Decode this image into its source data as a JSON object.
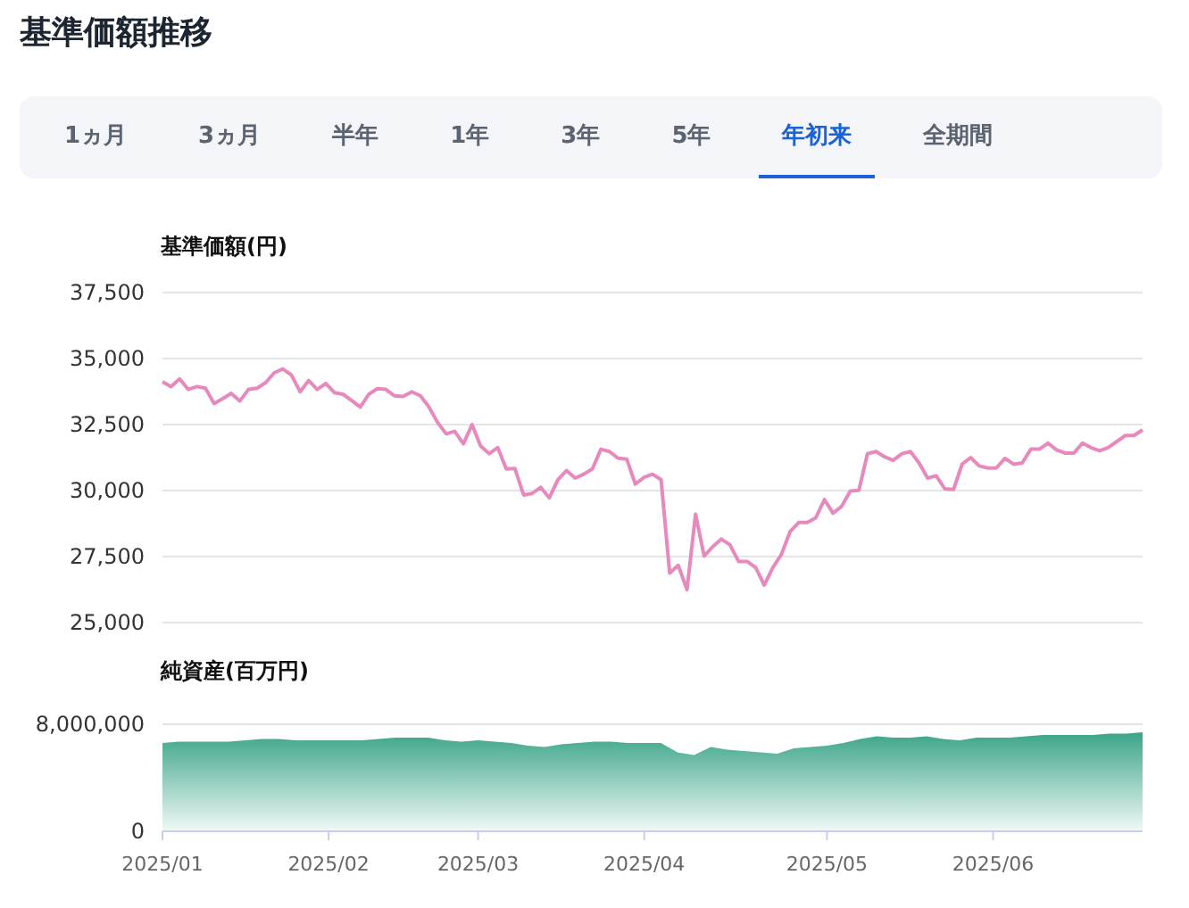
{
  "title": "基準価額推移",
  "tabs": [
    {
      "label": "1ヵ月",
      "selected": false
    },
    {
      "label": "3ヵ月",
      "selected": false
    },
    {
      "label": "半年",
      "selected": false
    },
    {
      "label": "1年",
      "selected": false
    },
    {
      "label": "3年",
      "selected": false
    },
    {
      "label": "5年",
      "selected": false
    },
    {
      "label": "年初来",
      "selected": true
    },
    {
      "label": "全期間",
      "selected": false
    }
  ],
  "price_chart": {
    "chart_data": {
      "type": "line",
      "grid": true,
      "ylabel": "基準価額(円)",
      "ylim": [
        25000,
        37500
      ],
      "yticks": [
        {
          "value": 25000,
          "label": "25,000"
        },
        {
          "value": 27500,
          "label": "27,500"
        },
        {
          "value": 30000,
          "label": "30,000"
        },
        {
          "value": 32500,
          "label": "32,500"
        },
        {
          "value": 35000,
          "label": "35,000"
        },
        {
          "value": 37500,
          "label": "37,500"
        }
      ],
      "categories": [
        null,
        null,
        null,
        null,
        null,
        null,
        null,
        null,
        null,
        null,
        null,
        null,
        null,
        null,
        null,
        null,
        null,
        null,
        null,
        null,
        null,
        null,
        null,
        null,
        null,
        null,
        null,
        null,
        null,
        null,
        null,
        null,
        null,
        null,
        null,
        null,
        null,
        null,
        null,
        null,
        null,
        null,
        null,
        null,
        null,
        null,
        null,
        null,
        null,
        null,
        null,
        null,
        null,
        null,
        null,
        null,
        null,
        null,
        null,
        null,
        null,
        null,
        null,
        null,
        null,
        null,
        null,
        null,
        null,
        null,
        null,
        null,
        null,
        null,
        null,
        null,
        null,
        null,
        null,
        null,
        null,
        null,
        null,
        null,
        null,
        null,
        null,
        null,
        null,
        null,
        null,
        null,
        null,
        null,
        null,
        null,
        null,
        null,
        null,
        null,
        null,
        null,
        null,
        null,
        null,
        null,
        null,
        null,
        null,
        null,
        null,
        null,
        null,
        null,
        null
      ],
      "series": [
        {
          "color": "#e889bd",
          "values": [
            34120,
            33940,
            34230,
            33830,
            33940,
            33880,
            33300,
            33480,
            33680,
            33390,
            33830,
            33880,
            34090,
            34460,
            34610,
            34380,
            33740,
            34170,
            33830,
            34060,
            33710,
            33650,
            33420,
            33160,
            33650,
            33860,
            33830,
            33590,
            33570,
            33740,
            33590,
            33160,
            32580,
            32150,
            32240,
            31770,
            32500,
            31690,
            31400,
            31630,
            30820,
            30840,
            29830,
            29890,
            30120,
            29720,
            30410,
            30760,
            30470,
            30620,
            30820,
            31570,
            31480,
            31220,
            31190,
            30240,
            30500,
            30620,
            30410,
            26880,
            27170,
            26250,
            29110,
            27520,
            27870,
            28160,
            27950,
            27320,
            27320,
            27080,
            26420,
            27080,
            27580,
            28450,
            28790,
            28790,
            28970,
            29660,
            29140,
            29400,
            29980,
            30010,
            31400,
            31480,
            31280,
            31140,
            31400,
            31480,
            31050,
            30470,
            30560,
            30070,
            30040,
            31000,
            31250,
            30930,
            30850,
            30850,
            31220,
            31000,
            31050,
            31570,
            31570,
            31800,
            31540,
            31420,
            31420,
            31800,
            31630,
            31510,
            31630,
            31860,
            32090,
            32090,
            32300
          ]
        }
      ]
    }
  },
  "assets_chart": {
    "chart_data": {
      "type": "area",
      "ylabel": "純資産(百万円)",
      "ylim": [
        0,
        8000000
      ],
      "yticks": [
        {
          "value": 0,
          "label": "0"
        },
        {
          "value": 8000000,
          "label": "8,000,000"
        }
      ],
      "categories": [
        "2025/01",
        null,
        null,
        null,
        null,
        null,
        null,
        null,
        null,
        null,
        "2025/02",
        null,
        null,
        null,
        null,
        null,
        null,
        null,
        null,
        "2025/03",
        null,
        null,
        null,
        null,
        null,
        null,
        null,
        null,
        null,
        "2025/04",
        null,
        null,
        null,
        null,
        null,
        null,
        null,
        null,
        null,
        null,
        "2025/05",
        null,
        null,
        null,
        null,
        null,
        null,
        null,
        null,
        null,
        "2025/06",
        null,
        null,
        null,
        null,
        null,
        null,
        null,
        null,
        null
      ],
      "series": [
        {
          "color": "#0a8f6c",
          "values": [
            6600000,
            6700000,
            6700000,
            6700000,
            6700000,
            6800000,
            6900000,
            6900000,
            6800000,
            6800000,
            6800000,
            6800000,
            6800000,
            6900000,
            7000000,
            7000000,
            7000000,
            6800000,
            6700000,
            6800000,
            6700000,
            6600000,
            6400000,
            6300000,
            6500000,
            6600000,
            6700000,
            6700000,
            6600000,
            6600000,
            6600000,
            5900000,
            5700000,
            6300000,
            6100000,
            6000000,
            5900000,
            5800000,
            6200000,
            6300000,
            6400000,
            6600000,
            6900000,
            7100000,
            7000000,
            7000000,
            7100000,
            6900000,
            6800000,
            7000000,
            7000000,
            7000000,
            7100000,
            7200000,
            7200000,
            7200000,
            7200000,
            7300000,
            7300000,
            7400000
          ]
        }
      ]
    }
  }
}
